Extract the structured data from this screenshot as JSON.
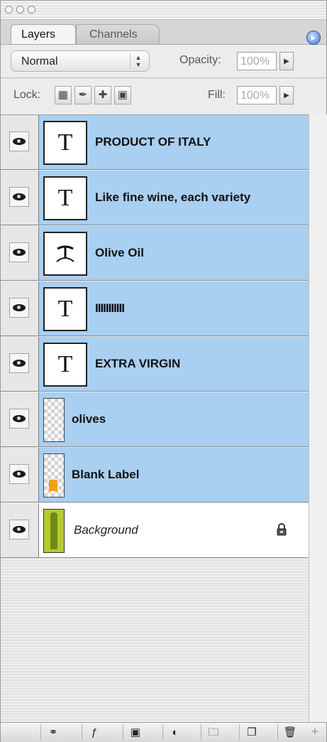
{
  "tabs": {
    "layers": "Layers",
    "channels": "Channels"
  },
  "blend": {
    "mode": "Normal",
    "opacity_label": "Opacity:",
    "opacity_value": "100%"
  },
  "lock": {
    "label": "Lock:",
    "fill_label": "Fill:",
    "fill_value": "100%"
  },
  "layers": [
    {
      "name": "PRODUCT OF ITALY",
      "kind": "text",
      "thumb": "T",
      "selected": true
    },
    {
      "name": "Like fine wine,  each variety",
      "kind": "text",
      "thumb": "T",
      "selected": true
    },
    {
      "name": "Olive Oil",
      "kind": "warp-text",
      "thumb": "T",
      "selected": true
    },
    {
      "name": "IIIIIIIIIII",
      "kind": "text",
      "thumb": "T",
      "selected": true
    },
    {
      "name": "EXTRA VIRGIN",
      "kind": "text",
      "thumb": "T",
      "selected": true
    },
    {
      "name": "olives",
      "kind": "pixel",
      "thumb": "",
      "selected": true
    },
    {
      "name": "Blank Label",
      "kind": "pixel",
      "thumb": "",
      "selected": true
    },
    {
      "name": "Background",
      "kind": "background",
      "thumb": "",
      "selected": false,
      "locked": true
    }
  ],
  "colors": {
    "selection": "#a9cff1",
    "accent": "#3e79d6"
  },
  "footer_icons": [
    "link-icon",
    "layer-style-icon",
    "mask-icon",
    "adjustment-icon",
    "folder-icon",
    "new-layer-icon",
    "trash-icon"
  ]
}
